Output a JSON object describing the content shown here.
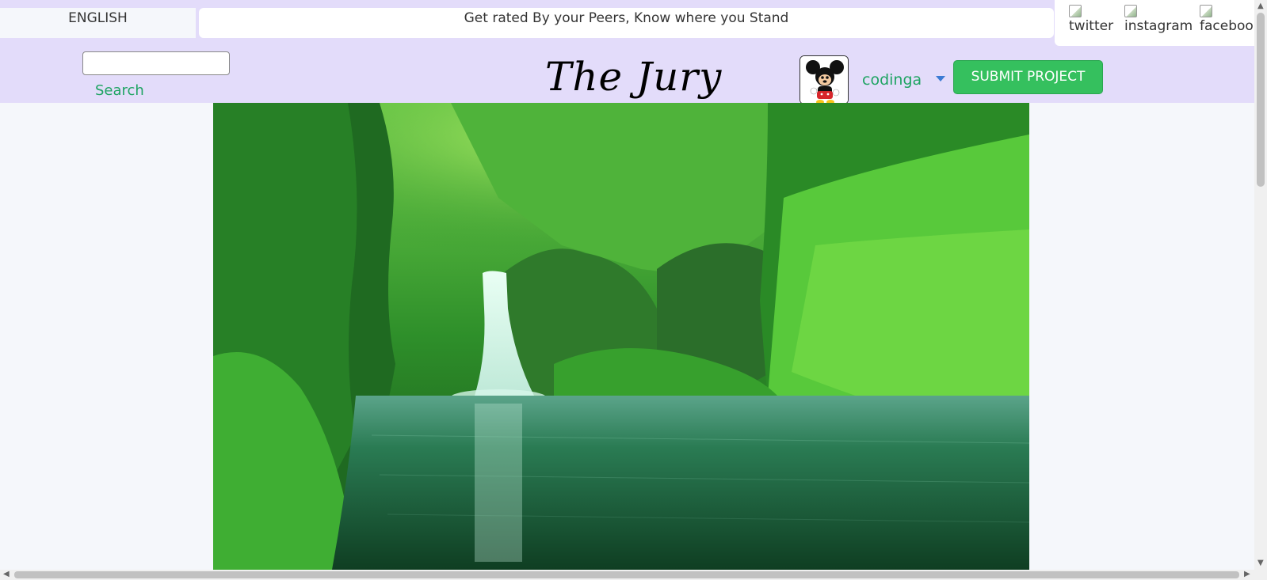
{
  "topbar": {
    "language": "ENGLISH",
    "tagline": "Get rated By your Peers, Know where you Stand",
    "social": [
      {
        "alt": "twitter",
        "icon": "twitter-icon"
      },
      {
        "alt": "instagram",
        "icon": "instagram-icon"
      },
      {
        "alt": "faceboo",
        "icon": "facebook-icon"
      }
    ]
  },
  "header": {
    "search_placeholder": "",
    "search_label": "Search",
    "brand": "The Jury",
    "avatar_icon": "mickey-mouse-avatar",
    "username": "codinga",
    "submit_label": "SUBMIT PROJECT"
  },
  "hero": {
    "image": "waterfall-forest-photo"
  },
  "colors": {
    "header_bg": "#e3dcfa",
    "accent_green": "#1fa463",
    "button_green": "#35c05e"
  }
}
